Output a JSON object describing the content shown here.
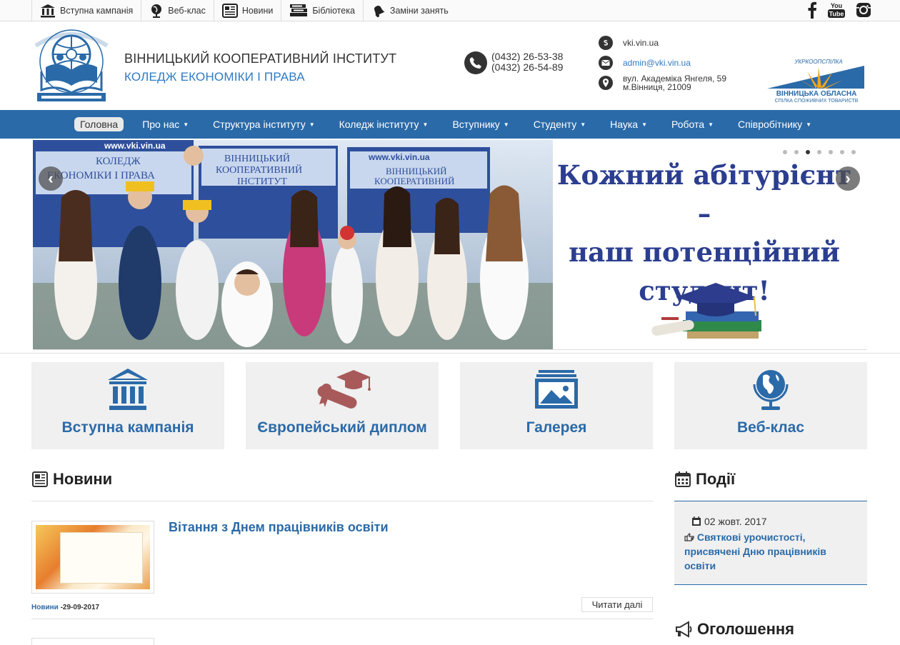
{
  "topnav": [
    {
      "label": "Вступна кампанія",
      "icon": "bank-icon"
    },
    {
      "label": "Веб-клас",
      "icon": "globe-icon"
    },
    {
      "label": "Новини",
      "icon": "newspaper-icon"
    },
    {
      "label": "Бібліотека",
      "icon": "books-icon"
    },
    {
      "label": "Заміни занять",
      "icon": "bell-icon"
    }
  ],
  "social": [
    "facebook-icon",
    "youtube-icon",
    "instagram-icon"
  ],
  "social_youtube_text": {
    "you": "You",
    "tube": "Tube"
  },
  "header": {
    "institute": "ВІННИЦЬКИЙ КООПЕРАТИВНИЙ ІНСТИТУТ",
    "college": "КОЛЕДЖ ЕКОНОМІКИ І ПРАВА",
    "phone1": "(0432) 26-53-38",
    "phone2": "(0432) 26-54-89",
    "skype": "vki.vin.ua",
    "email": "admin@vki.vin.ua",
    "address1": "вул. Академіка Янгеля, 59",
    "address2": "м.Вінниця, 21009",
    "union_top": "УКРКООПСПІЛКА",
    "union_name": "ВІННИЦЬКА ОБЛАСНА",
    "union_sub": "СПІЛКА СПОЖИВЧИХ ТОВАРИСТВ"
  },
  "mainnav": [
    {
      "label": "Головна",
      "active": true
    },
    {
      "label": "Про нас"
    },
    {
      "label": "Структура інституту"
    },
    {
      "label": "Коледж інституту"
    },
    {
      "label": "Вступнику"
    },
    {
      "label": "Студенту"
    },
    {
      "label": "Наука"
    },
    {
      "label": "Робота"
    },
    {
      "label": "Співробітнику"
    }
  ],
  "slider": {
    "line1": "Кожний абітурієнт –",
    "line2": "наш потенційний",
    "line3": "студент!",
    "banner_url": "www.vki.vin.ua",
    "banner_l1": "ВІННИЦЬКИЙ",
    "banner_l2": "КООПЕРАТИВНИЙ",
    "banner_l3": "ІНСТИТУТ",
    "banner_left_l1": "КОЛЕДЖ",
    "banner_left_l2": "ЕКОНОМІКИ І ПРАВА"
  },
  "tiles": [
    {
      "label": "Вступна кампанія",
      "icon": "bank-icon"
    },
    {
      "label": "Європейський диплом",
      "icon": "diploma-icon"
    },
    {
      "label": "Галерея",
      "icon": "gallery-icon"
    },
    {
      "label": "Веб-клас",
      "icon": "globe-icon"
    }
  ],
  "news": {
    "title": "Новини",
    "item_title": "Вітання з Днем працівників освіти",
    "category": "Новини",
    "date": "-29-09-2017",
    "readmore": "Читати далі"
  },
  "events": {
    "title": "Події",
    "date": "02 жовт. 2017",
    "link": "Святкові урочистості, присвячені Дню працівників освіти"
  },
  "announcements": {
    "title": "Оголошення"
  },
  "colors": {
    "accent": "#2b6aa8",
    "tile_bg": "#f0f0f0",
    "diploma": "#a85a5a"
  }
}
